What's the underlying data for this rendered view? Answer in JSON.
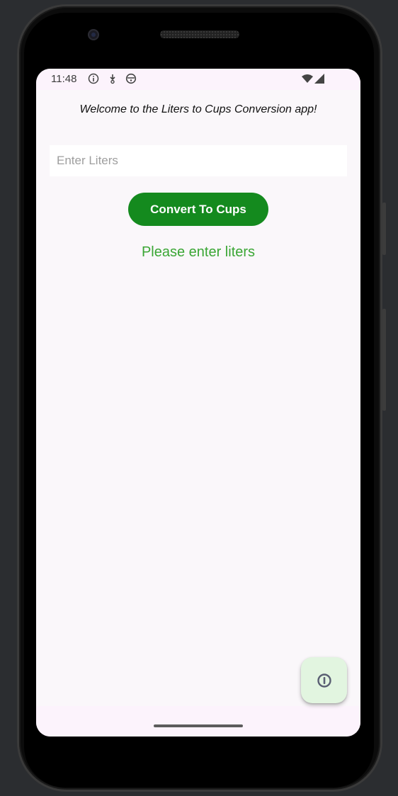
{
  "status_bar": {
    "time": "11:48",
    "left_icons": [
      "info-icon",
      "download-icon",
      "smiley-icon"
    ],
    "right_icons": [
      "wifi-icon",
      "signal-icon"
    ]
  },
  "app": {
    "welcome_text": "Welcome to the Liters to Cups Conversion app!",
    "input": {
      "value": "",
      "placeholder": "Enter Liters"
    },
    "convert_button_label": "Convert To Cups",
    "result_text": "Please enter liters",
    "fab_icon": "info-icon"
  },
  "colors": {
    "button_bg": "#148a1e",
    "result_text": "#3aa634",
    "fab_bg": "#e2f5e0"
  }
}
